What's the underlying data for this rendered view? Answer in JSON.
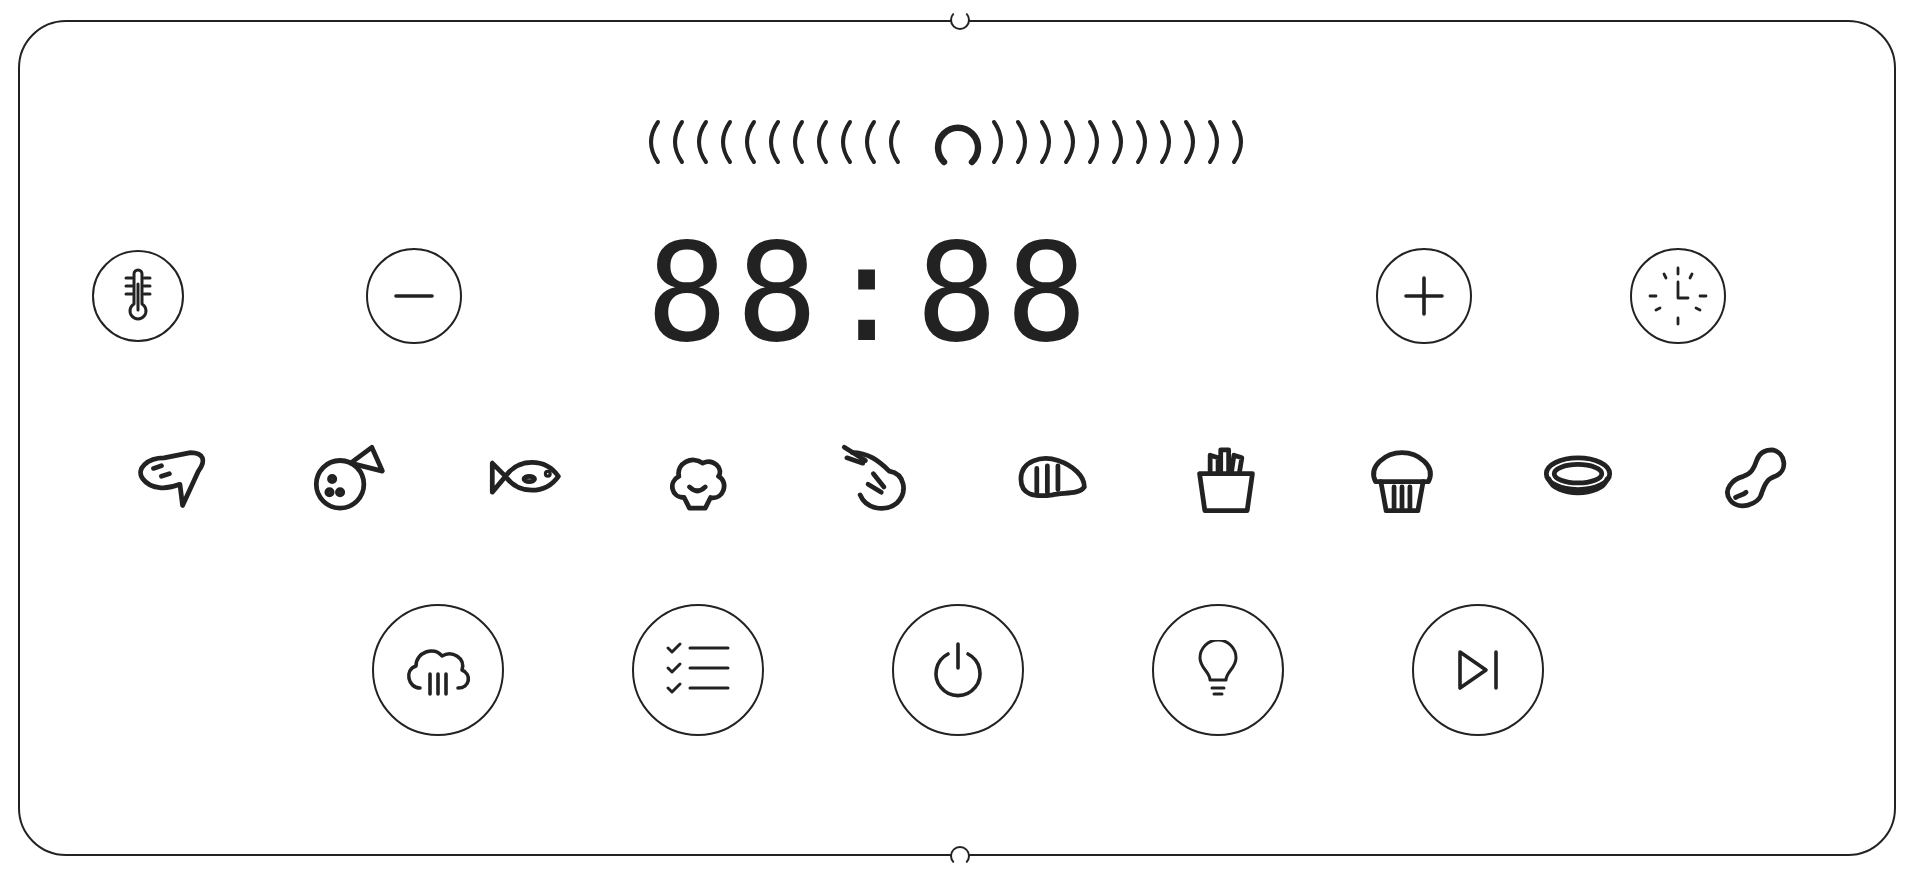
{
  "display": {
    "time": "88:88"
  }
}
